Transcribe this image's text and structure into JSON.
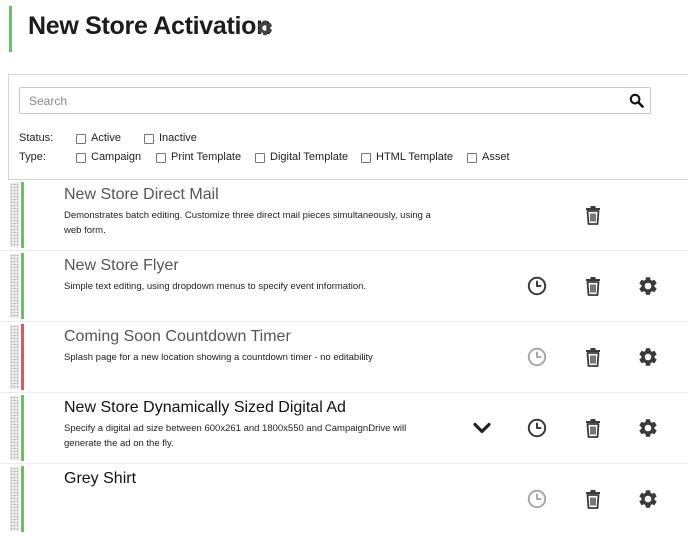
{
  "page": {
    "title": "New Store Activation"
  },
  "search": {
    "placeholder": "Search",
    "value": ""
  },
  "filters": {
    "status": {
      "label": "Status:",
      "options": [
        {
          "label": "Active",
          "checked": false
        },
        {
          "label": "Inactive",
          "checked": false
        }
      ]
    },
    "type": {
      "label": "Type:",
      "options": [
        {
          "label": "Campaign",
          "checked": false
        },
        {
          "label": "Print Template",
          "checked": false
        },
        {
          "label": "Digital Template",
          "checked": false
        },
        {
          "label": "HTML Template",
          "checked": false
        },
        {
          "label": "Asset",
          "checked": false
        }
      ]
    }
  },
  "colors": {
    "active": "#6cbf6a",
    "inactive": "#e0585e",
    "icon_dark": "#3a3a3a",
    "icon_light": "#a8a8a8"
  },
  "items": [
    {
      "title": "New Store Direct Mail",
      "description": "Demonstrates batch editing. Customize three direct mail pieces simultaneously, using a web form.",
      "status": "active",
      "icons": [
        "trash-icon"
      ]
    },
    {
      "title": "New Store Flyer",
      "description": "Simple text editing, using dropdown menus to specify event information.",
      "status": "active",
      "icons": [
        "clock-icon",
        "trash-icon",
        "gear-icon"
      ]
    },
    {
      "title": "Coming Soon Countdown Timer",
      "description": "Splash page for a new location showing a countdown timer - no editability",
      "status": "inactive",
      "icons": [
        "clock-icon",
        "trash-icon",
        "gear-icon"
      ]
    },
    {
      "title": "New Store Dynamically Sized Digital Ad",
      "description": "Specify a digital ad size between 600x261 and 1800x550 and CampaignDrive will generate the ad on the fly.",
      "status": "active",
      "icons": [
        "chevron-down-icon",
        "clock-icon",
        "trash-icon",
        "gear-icon"
      ]
    },
    {
      "title": "Grey Shirt",
      "description": "",
      "status": "active",
      "icons": [
        "clock-icon",
        "trash-icon",
        "gear-icon"
      ]
    }
  ]
}
